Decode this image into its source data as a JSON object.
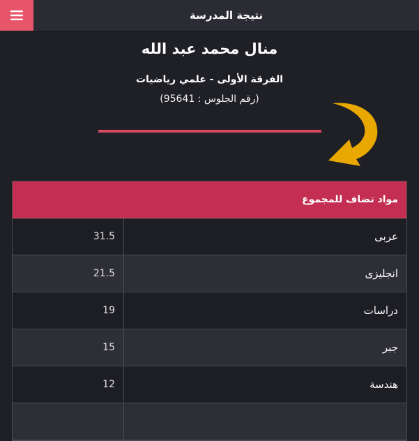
{
  "header": {
    "title": "نتيجة المدرسة",
    "menu_icon": "hamburger-menu-icon",
    "accent_color": "#e8566b"
  },
  "student": {
    "name": "منال محمد عبد الله",
    "class": "الفرقة الأولى - علمي رياضيات",
    "seat_number": "(رقم الجلوس : 95641)"
  },
  "decor": {
    "arrow_icon": "curved-arrow-icon",
    "arrow_color": "#e8a800",
    "divider_color": "#d34a5f"
  },
  "table": {
    "header": "مواد تضاف للمجموع",
    "header_color": "#c42e52",
    "rows": [
      {
        "subject": "عربى",
        "score": "31.5"
      },
      {
        "subject": "انجليزى",
        "score": "21.5"
      },
      {
        "subject": "دراسات",
        "score": "19"
      },
      {
        "subject": "جبر",
        "score": "15"
      },
      {
        "subject": "هندسة",
        "score": "12"
      }
    ]
  }
}
